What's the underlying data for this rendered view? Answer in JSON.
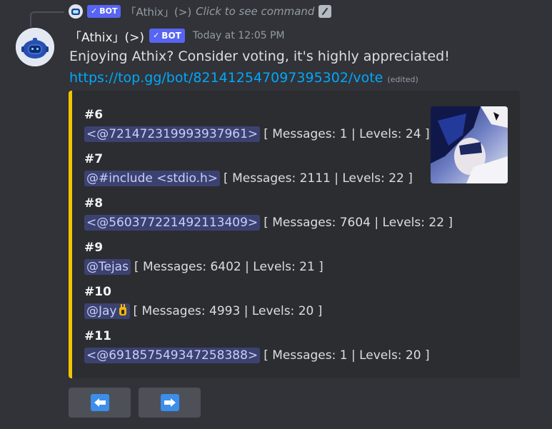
{
  "reply": {
    "bot_label": "BOT",
    "name": "「Athix」(>)",
    "text": "Click to see command"
  },
  "message": {
    "author": "「Athix」(>)",
    "bot_label": "BOT",
    "timestamp": "Today at 12:05 PM",
    "line1": "Enjoying Athix? Consider voting, it's highly appreciated!",
    "link": "https://top.gg/bot/821412547097395302/vote",
    "edited": "(edited)"
  },
  "embed": {
    "accent_color": "#f5c400",
    "entries": [
      {
        "rank": "#6",
        "mention": "<@721472319993937961>",
        "stats": "[ Messages: 1 | Levels: 24 ]"
      },
      {
        "rank": "#7",
        "mention": "@#include <stdio.h>",
        "stats": "[ Messages: 2111 | Levels: 22 ]"
      },
      {
        "rank": "#8",
        "mention": "<@560377221492113409>",
        "stats": "[ Messages: 7604 | Levels: 22 ]"
      },
      {
        "rank": "#9",
        "mention": "@Tejas",
        "stats": "[ Messages: 6402 | Levels: 21 ]"
      },
      {
        "rank": "#10",
        "mention": "@Jay",
        "stats": "[ Messages: 4993 | Levels: 20 ]"
      },
      {
        "rank": "#11",
        "mention": "<@691857549347258388>",
        "stats": "[ Messages: 1 | Levels: 20 ]"
      }
    ]
  },
  "buttons": [
    {
      "icon": "arrow-left-icon"
    },
    {
      "icon": "arrow-right-icon"
    }
  ]
}
